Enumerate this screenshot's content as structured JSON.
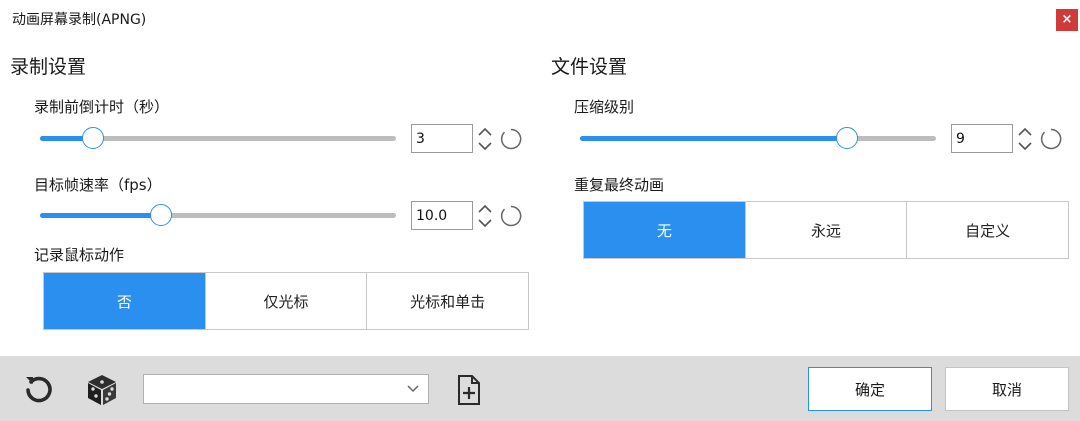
{
  "window": {
    "title": "动画屏幕录制(APNG)",
    "close_label": "×"
  },
  "record": {
    "section_title": "录制设置",
    "countdown": {
      "label": "录制前倒计时（秒）",
      "value": "3",
      "fraction": 0.15
    },
    "fps": {
      "label": "目标帧速率（fps）",
      "value": "10.0",
      "fraction": 0.34
    },
    "mouse": {
      "label": "记录鼠标动作",
      "options": [
        "否",
        "仅光标",
        "光标和单击"
      ],
      "selected": 0
    }
  },
  "file": {
    "section_title": "文件设置",
    "compression": {
      "label": "压缩级别",
      "value": "9",
      "fraction": 0.75
    },
    "repeat": {
      "label": "重复最终动画",
      "options": [
        "无",
        "永远",
        "自定义"
      ],
      "selected": 0
    }
  },
  "footer": {
    "preset_value": "",
    "ok_label": "确定",
    "cancel_label": "取消"
  },
  "colors": {
    "accent": "#2b8ff0",
    "close": "#cf3b3b",
    "footer_bg": "#dcdcdc"
  }
}
